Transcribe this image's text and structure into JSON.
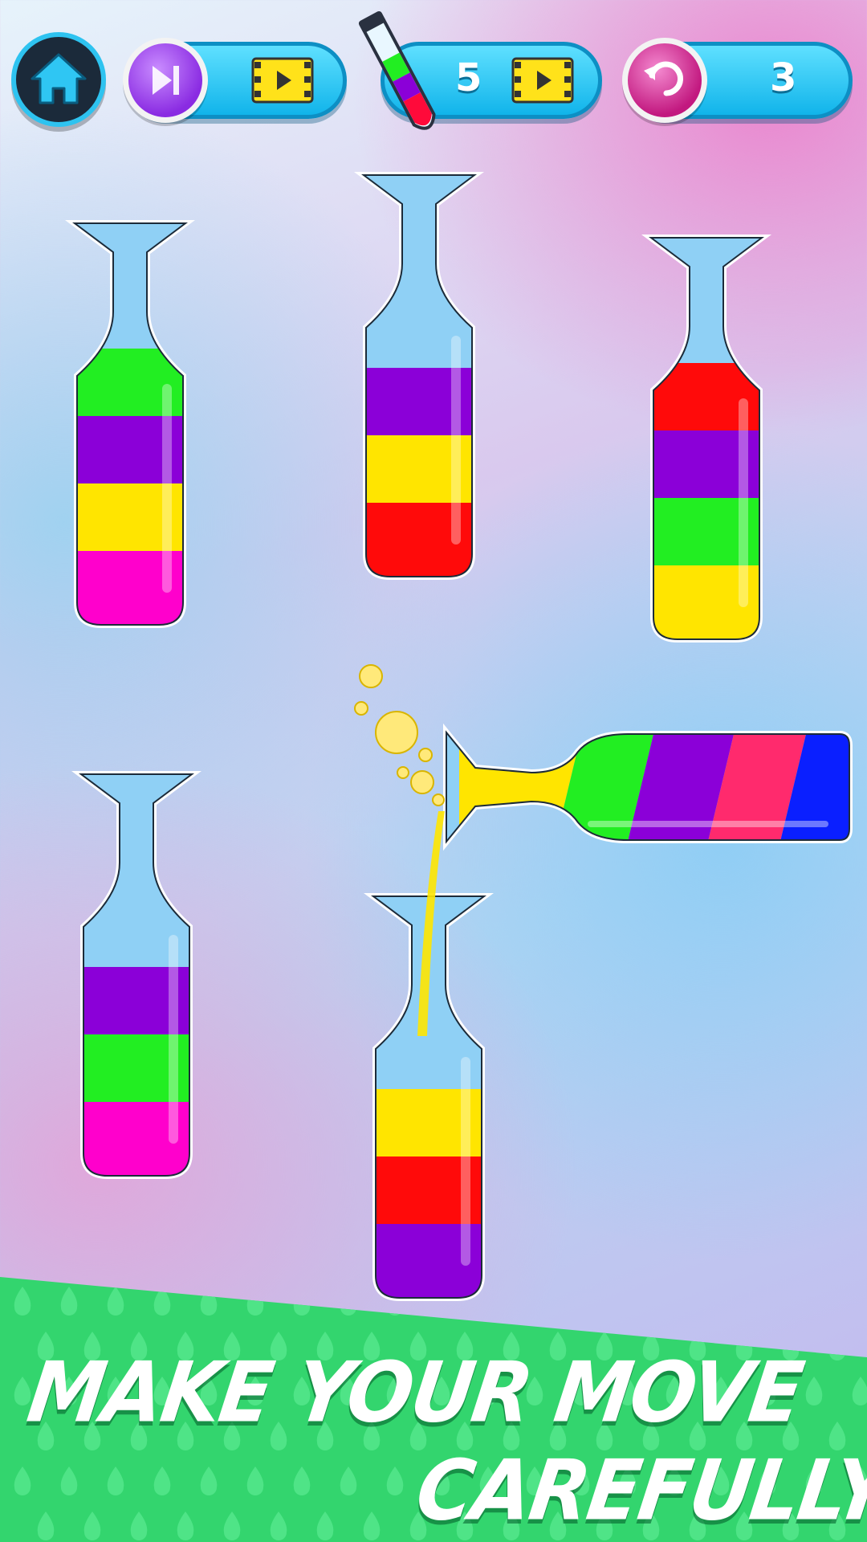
{
  "hud": {
    "home_icon": "home-icon",
    "skip": {
      "icon": "skip-forward-icon",
      "video_icon": "video-ad-icon"
    },
    "add_tube": {
      "icon": "test-tube-icon",
      "count": "5",
      "video_icon": "video-ad-icon"
    },
    "undo": {
      "icon": "undo-icon",
      "count": "3"
    }
  },
  "colors": {
    "green": "#22ee22",
    "purple": "#8b00d8",
    "yellow": "#ffe500",
    "magenta": "#ff00cc",
    "red": "#ff0a0a",
    "pink": "#ff2a6d",
    "blue": "#0a1fff",
    "empty": "#8fd0f5",
    "hud_blue": "#2ec3f0",
    "banner_green": "#33d56e"
  },
  "bottles": [
    {
      "id": "bottle-1",
      "layers_bottom_to_top": [
        "magenta",
        "yellow",
        "purple",
        "green"
      ]
    },
    {
      "id": "bottle-2",
      "layers_bottom_to_top": [
        "red",
        "yellow",
        "purple"
      ]
    },
    {
      "id": "bottle-3",
      "layers_bottom_to_top": [
        "yellow",
        "green",
        "purple",
        "red"
      ]
    },
    {
      "id": "bottle-4",
      "layers_bottom_to_top": [
        "magenta",
        "green",
        "purple"
      ]
    },
    {
      "id": "bottle-5",
      "layers_bottom_to_top": [
        "purple",
        "red",
        "yellow"
      ],
      "receiving_pour": "yellow"
    },
    {
      "id": "bottle-6-pouring",
      "layers_neck_to_base": [
        "yellow",
        "green",
        "purple",
        "pink",
        "blue"
      ],
      "state": "tilted-pouring"
    }
  ],
  "banner": {
    "line1": "MAKE YOUR MOVE",
    "line2": "CAREFULLY"
  }
}
